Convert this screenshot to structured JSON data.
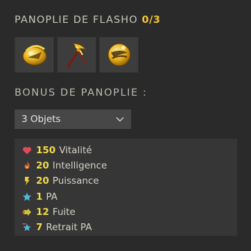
{
  "panoply": {
    "title": "PANOPLIE DE FLASHO",
    "count": "0/3",
    "items": [
      {
        "icon": "golden-amulet-icon"
      },
      {
        "icon": "golden-bow-icon"
      },
      {
        "icon": "golden-ring-icon"
      }
    ]
  },
  "bonus": {
    "title": "BONUS DE PANOPLIE :",
    "selector": {
      "selected": "3 Objets"
    },
    "stats": [
      {
        "value": "150",
        "label": "Vitalité",
        "icon": "heart-icon",
        "color": "#e04a58"
      },
      {
        "value": "20",
        "label": "Intelligence",
        "icon": "fire-icon",
        "color": "#e0662a"
      },
      {
        "value": "20",
        "label": "Puissance",
        "icon": "lightning-icon",
        "color": "#f2cf3a"
      },
      {
        "value": "1",
        "label": "PA",
        "icon": "star-icon",
        "color": "#4fb9dc"
      },
      {
        "value": "12",
        "label": "Fuite",
        "icon": "escape-icon",
        "color": "#c8c23a"
      },
      {
        "value": "7",
        "label": "Retrait PA",
        "icon": "star-minus-icon",
        "color": "#4fb9dc"
      }
    ]
  },
  "colors": {
    "stat_value": "#f4dc42",
    "stat_label": "#d6d3c6",
    "title_count": "#f2c432"
  }
}
